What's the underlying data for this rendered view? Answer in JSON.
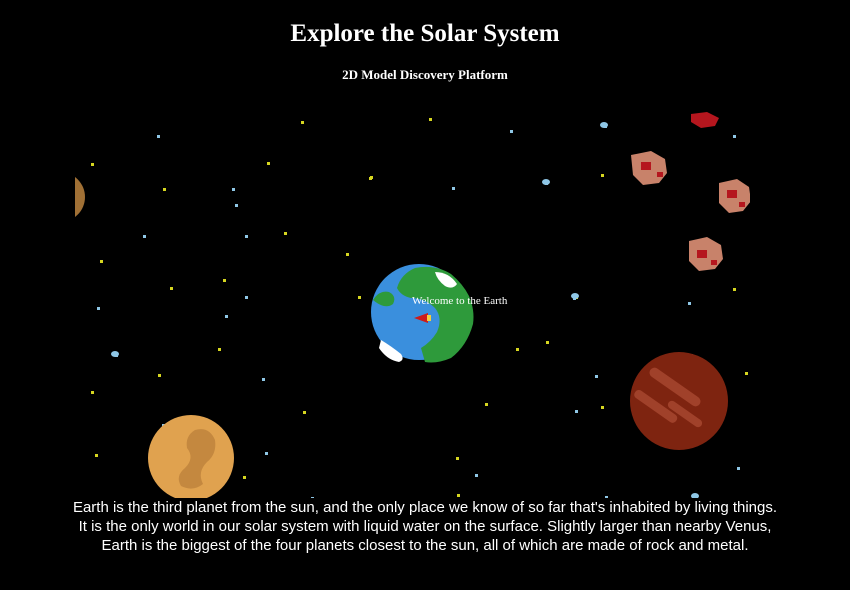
{
  "header": {
    "title": "Explore the Solar System",
    "subtitle": "2D Model Discovery Platform"
  },
  "scene": {
    "earth_label": "Welcome to the Earth",
    "colors": {
      "background": "#000000",
      "star_yellow": "#d6d620",
      "star_blue": "#8fc7e6",
      "ocean": "#3a8fdd",
      "land": "#2e9a3b",
      "ice": "#ffffff",
      "mars": "#7e2410",
      "mars_stripe": "#a0412a",
      "venus": "#e0a24f",
      "venus_spot": "#c4883f",
      "asteroid": "#c8826a",
      "ship": "#cc1b1b"
    }
  },
  "description": "Earth is the third planet from the sun, and the only place we know of so far that's inhabited by living things. It is the only world in our solar system with liquid water on the surface. Slightly larger than nearby Venus, Earth is the biggest of the four planets closest to the sun, all of which are made of rock and metal."
}
